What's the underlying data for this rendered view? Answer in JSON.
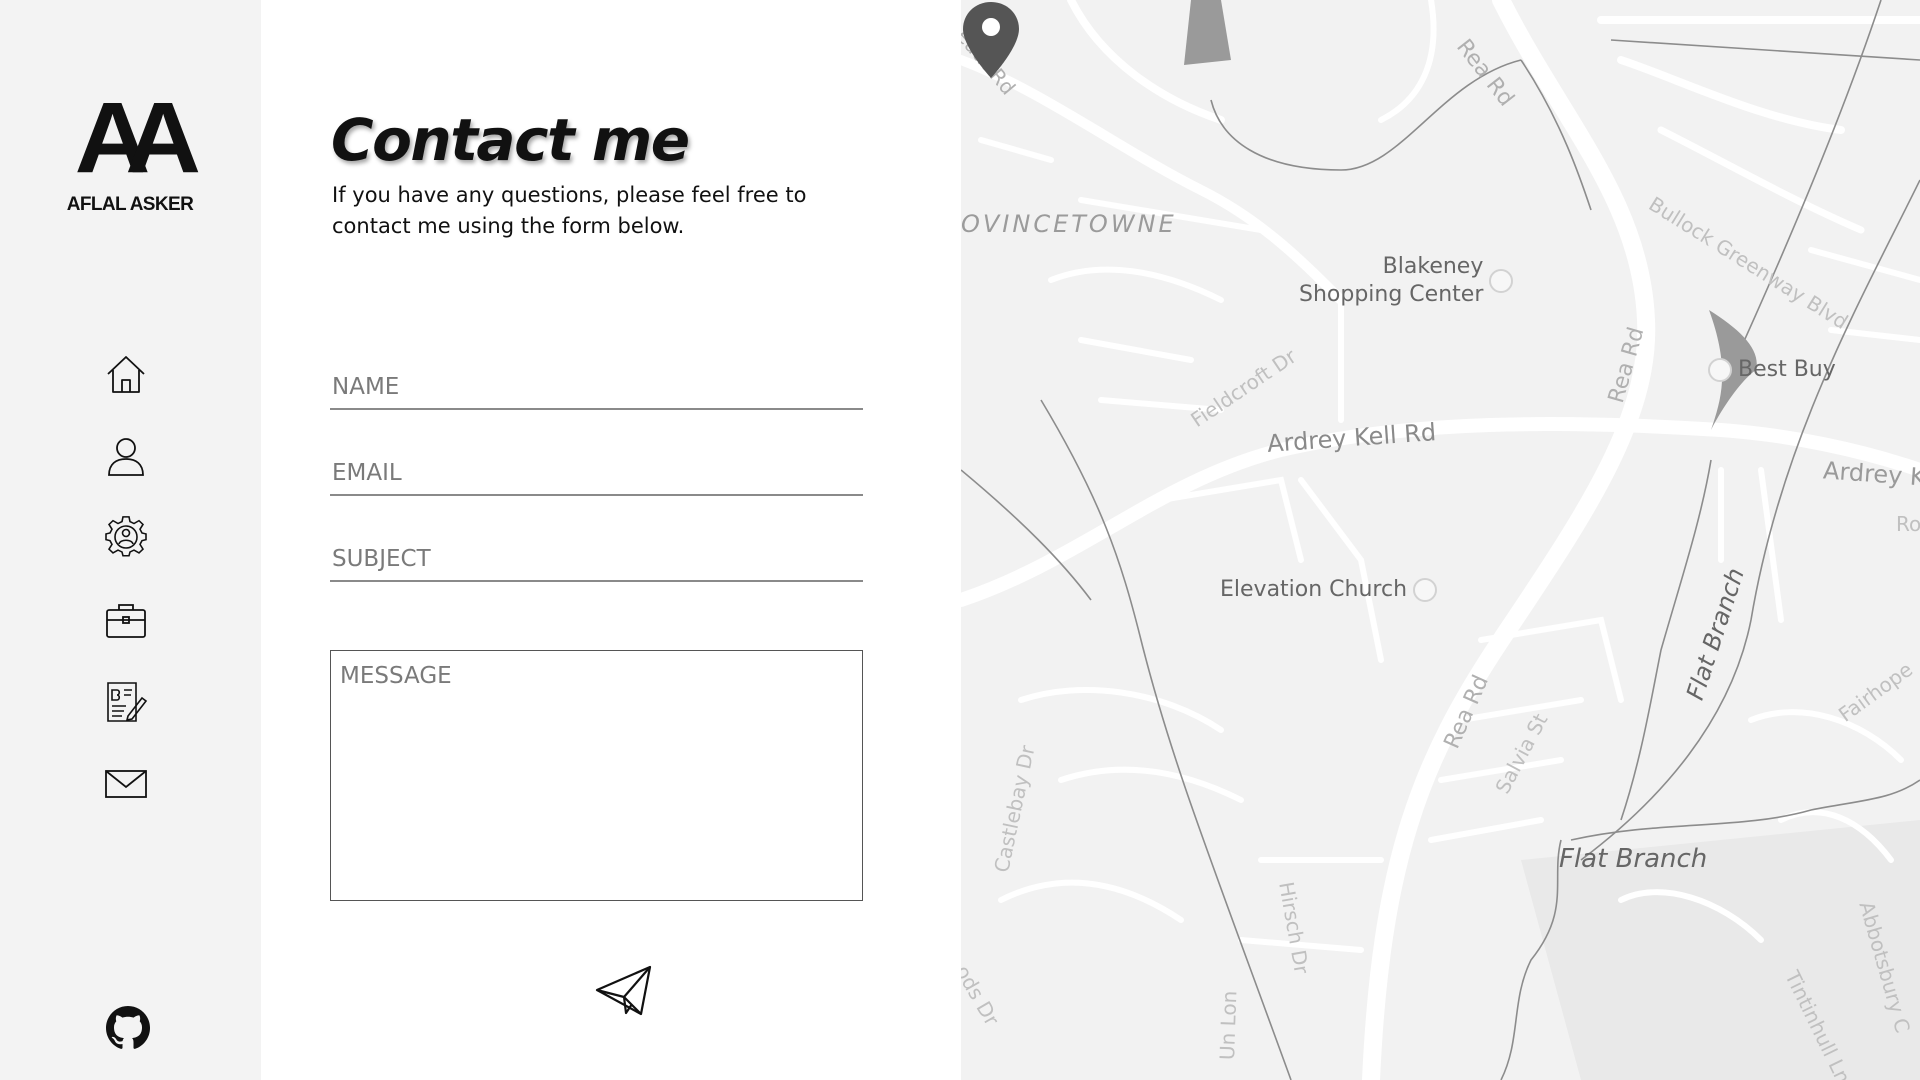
{
  "sidebar": {
    "logo_mark": "AA",
    "logo_name": "AFLAL ASKER",
    "nav_icons": [
      "home-icon",
      "user-icon",
      "gear-icon",
      "briefcase-icon",
      "blog-icon",
      "mail-icon"
    ],
    "footer_icon": "github-icon"
  },
  "content": {
    "title": "Contact me",
    "subtitle": "If you have any questions, please feel free to contact me using the form below.",
    "form": {
      "name_placeholder": "NAME",
      "email_placeholder": "EMAIL",
      "subject_placeholder": "SUBJECT",
      "message_placeholder": "MESSAGE",
      "submit_icon": "send-icon"
    }
  },
  "map": {
    "neighborhood": "OVINCETOWNE",
    "pois": {
      "blakeney_line1": "Blakeney",
      "blakeney_line2": "Shopping Center",
      "best_buy": "Best Buy",
      "elevation_church": "Elevation Church"
    },
    "roads": {
      "ardrey_kell": "Ardrey Kell Rd",
      "ardrey_right": "Ardrey K",
      "rea_rd": "Rea Rd",
      "fieldcroft": "Fieldcroft Dr",
      "bullock": "Bullock Greenway Blvd",
      "heath": "eath Rd",
      "castlebay": "Castlebay Dr",
      "hirsch": "Hirsch Dr",
      "salvia": "Salvia St",
      "fairhope": "Fairhope",
      "abbotsbury": "Abbotsbury C",
      "tintinhull": "Tintinhull Ln",
      "ods": "ods Dr",
      "ro": "Ro",
      "uni": "Un Lon"
    },
    "water": {
      "flat_branch_stream": "Flat Branch",
      "flat_branch_area": "Flat Branch"
    },
    "marker_icon": "map-pin-icon"
  },
  "colors": {
    "sidebar_bg": "#f3f3f3",
    "content_bg": "#ffffff",
    "map_bg": "#f2f2f2",
    "text": "#111111",
    "placeholder": "#7a7a7a"
  }
}
